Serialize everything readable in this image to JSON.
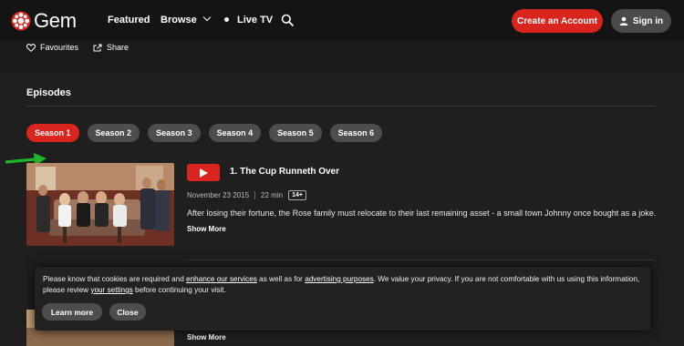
{
  "nav": {
    "logo_text": "Gem",
    "featured": "Featured",
    "browse": "Browse",
    "live_tv": "Live TV",
    "create_account": "Create an Account",
    "sign_in": "Sign in"
  },
  "actions": {
    "favourites": "Favourites",
    "share": "Share"
  },
  "episodes_title": "Episodes",
  "seasons": [
    "Season 1",
    "Season 2",
    "Season 3",
    "Season 4",
    "Season 5",
    "Season 6"
  ],
  "active_season": "Season 1",
  "episode": {
    "title": "1. The Cup Runneth Over",
    "date": "November 23 2015",
    "duration": "22 min",
    "rating": "14+",
    "description": "After losing their fortune, the Rose family must relocate to their last remaining asset - a small town Johnny once bought as a joke.",
    "show_more": "Show More"
  },
  "next_episode": {
    "show_more": "Show More"
  },
  "cookie": {
    "text_1": "Please know that cookies are required and ",
    "link_1": "enhance our services",
    "text_2": " as well as for ",
    "link_2": "advertising purposes",
    "text_3": ". We value your privacy. If you are not comfortable with us using this information, please review ",
    "link_3": "your settings",
    "text_4": " before continuing your visit.",
    "learn_more": "Learn more",
    "close": "Close"
  },
  "colors": {
    "accent": "#d9251d",
    "background": "#1f1f1f",
    "pill": "#4d4d4d",
    "arrow": "#1fb52a"
  }
}
